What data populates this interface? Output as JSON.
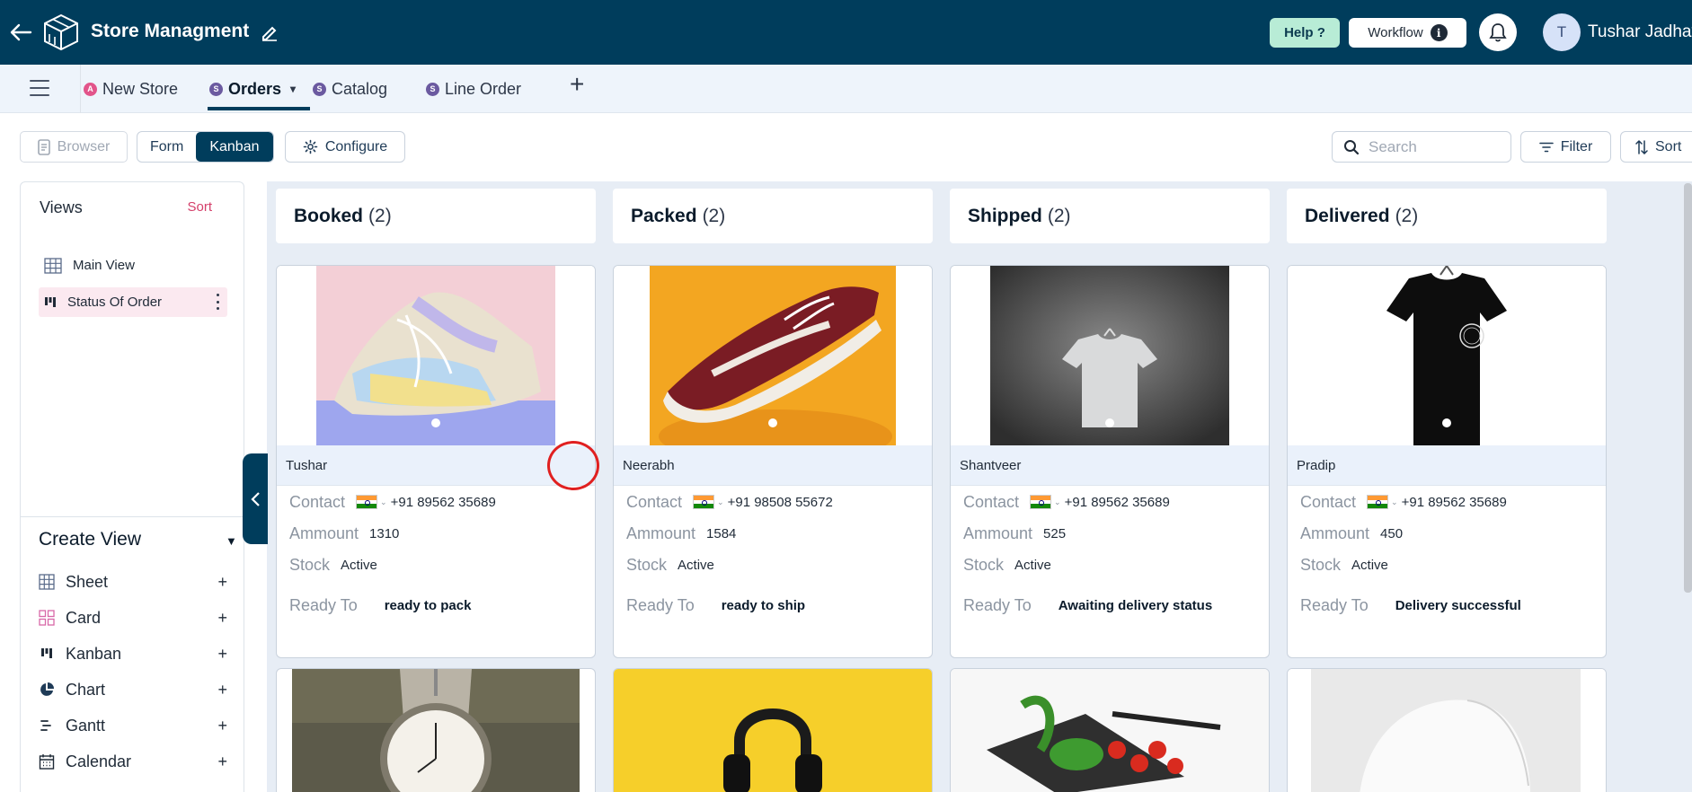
{
  "header": {
    "title": "Store Managment",
    "help_label": "Help ?",
    "workflow_label": "Workflow",
    "info_glyph": "i",
    "avatar_initial": "T",
    "user_name": "Tushar Jadhav"
  },
  "tabs": [
    {
      "label": "New Store",
      "badge": "A",
      "badge_color": "#e2548a"
    },
    {
      "label": "Orders",
      "badge": "S",
      "badge_color": "#6b5aa0"
    },
    {
      "label": "Catalog",
      "badge": "S",
      "badge_color": "#6b5aa0"
    },
    {
      "label": "Line Order",
      "badge": "S",
      "badge_color": "#6b5aa0"
    }
  ],
  "add_tab_glyph": "+",
  "toolbar": {
    "browser_label": "Browser",
    "form_label": "Form",
    "kanban_label": "Kanban",
    "configure_label": "Configure",
    "search_placeholder": "Search",
    "filter_label": "Filter",
    "sort_label": "Sort"
  },
  "sidebar": {
    "views_title": "Views",
    "views_sort": "Sort",
    "views": [
      {
        "label": "Main View",
        "icon": "grid-icon"
      },
      {
        "label": "Status Of Order",
        "icon": "kanban-icon"
      }
    ],
    "create_title": "Create View",
    "create_items": [
      {
        "label": "Sheet",
        "icon": "sheet-icon"
      },
      {
        "label": "Card",
        "icon": "card-icon"
      },
      {
        "label": "Kanban",
        "icon": "kanban-icon"
      },
      {
        "label": "Chart",
        "icon": "chart-icon"
      },
      {
        "label": "Gantt",
        "icon": "gantt-icon"
      },
      {
        "label": "Calendar",
        "icon": "calendar-icon"
      }
    ],
    "plus_glyph": "+"
  },
  "board": {
    "columns": [
      {
        "title": "Booked",
        "count": "(2)"
      },
      {
        "title": "Packed",
        "count": "(2)"
      },
      {
        "title": "Shipped",
        "count": "(2)"
      },
      {
        "title": "Delivered",
        "count": "(2)"
      }
    ],
    "field_labels": {
      "contact": "Contact",
      "amount": "Ammount",
      "stock": "Stock",
      "ready": "Ready To"
    },
    "cards": [
      {
        "name": "Tushar",
        "phone": "+91 89562 35689",
        "amount": "1310",
        "stock": "Active",
        "ready": "ready to pack",
        "image": "sneaker-photo"
      },
      {
        "name": "Neerabh",
        "phone": "+91 98508 55672",
        "amount": "1584",
        "stock": "Active",
        "ready": "ready to ship",
        "image": "red-sneaker-photo"
      },
      {
        "name": "Shantveer",
        "phone": "+91 89562 35689",
        "amount": "525",
        "stock": "Active",
        "ready": "Awaiting delivery status",
        "image": "white-tshirt-photo"
      },
      {
        "name": "Pradip",
        "phone": "+91 89562 35689",
        "amount": "450",
        "stock": "Active",
        "ready": "Delivery successful",
        "image": "black-tshirt-photo"
      }
    ],
    "second_row_images": [
      "pocket-watch-photo",
      "headphones-photo",
      "vegetables-photo",
      "white-cap-photo"
    ]
  },
  "colors": {
    "brand": "#003d5c",
    "accent_pink": "#d43f6a",
    "board_bg": "#e7edf5",
    "help_bg": "#b8ecd6"
  }
}
